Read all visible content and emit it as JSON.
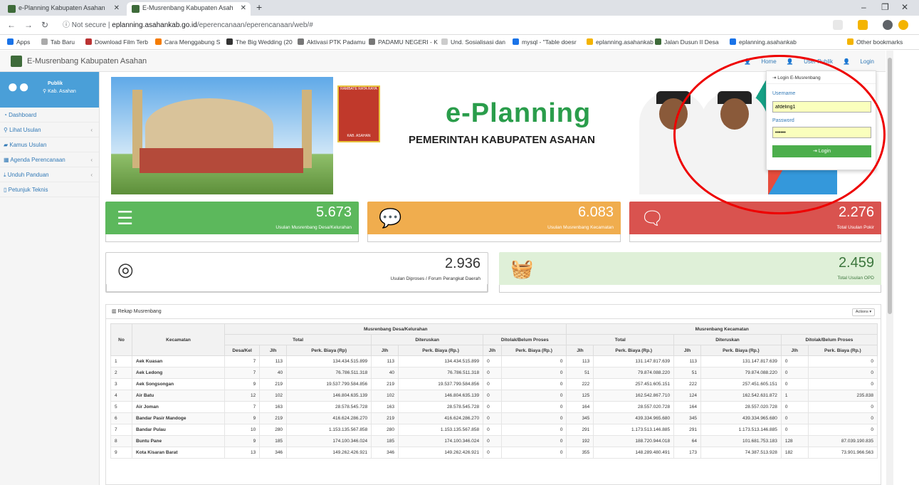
{
  "browser": {
    "tabs": [
      {
        "title": "e-Planning Kabupaten Asahan"
      },
      {
        "title": "E-Musrenbang Kabupaten Asah"
      }
    ],
    "url_prefix": "Not secure",
    "url_domain": "eplanning.asahankab.go.id",
    "url_path": "/eperencanaan/eperencanaan/web/#",
    "bookmarks": [
      "Apps",
      "Tab Baru",
      "Download Film Terb",
      "Cara Menggabung S",
      "The Big Wedding (20",
      "Aktivasi PTK Padamu",
      "PADAMU NEGERI - K",
      "Und. Sosialisasi dan",
      "mysql - \"Table doesr",
      "eplanning.asahankab",
      "Jalan Dusun II Desa",
      "eplanning.asahankab"
    ],
    "other_bookmarks": "Other bookmarks"
  },
  "app": {
    "title": "E-Musrenbang Kabupaten Asahan",
    "links": {
      "home": "Home",
      "user_publik": "User Publik",
      "login": "Login"
    }
  },
  "sidebar": {
    "user": "Publik",
    "location": "Kab. Asahan",
    "items": [
      {
        "label": "Dashboard",
        "has_children": false
      },
      {
        "label": "Lihat Usulan",
        "has_children": true
      },
      {
        "label": "Kamus Usulan",
        "has_children": false
      },
      {
        "label": "Agenda Perencanaan",
        "has_children": true
      },
      {
        "label": "Unduh Panduan",
        "has_children": true
      },
      {
        "label": "Petunjuk Teknis",
        "has_children": false
      }
    ]
  },
  "banner": {
    "brand": "e-Planning",
    "subtitle": "PEMERINTAH KABUPATEN ASAHAN",
    "emblem_top": "RAMBATE RATA RAYA",
    "emblem_bottom": "KAB. ASAHAN"
  },
  "login": {
    "header": "Login E-Musrenbang",
    "username_label": "Username",
    "username_value": "afdeling1",
    "password_label": "Password",
    "password_value": "••••••",
    "button": "Login"
  },
  "stats": [
    {
      "value": "5.673",
      "label": "Usulan Musrenbang Desa/Kelurahan",
      "color": "#5cb85c"
    },
    {
      "value": "6.083",
      "label": "Usulan Musrenbang Kecamatan",
      "color": "#f0ad4e"
    },
    {
      "value": "2.276",
      "label": "Total Usulan Pokir",
      "color": "#d9534f"
    },
    {
      "value": "2.936",
      "label": "Usulan Diproses / Forum Perangkat Daerah",
      "color": "#ffffff"
    },
    {
      "value": "2.459",
      "label": "Total Usulan OPD",
      "color": "#dff0d8"
    }
  ],
  "rekap": {
    "title": "Rekap Musrenbang",
    "actions": "Actions",
    "headers": {
      "no": "No",
      "kecamatan": "Kecamatan",
      "desa_group": "Musrenbang Desa/Kelurahan",
      "kec_group": "Musrenbang Kecamatan",
      "total": "Total",
      "diteruskan": "Diteruskan",
      "ditolak": "Ditolak/Belum Proses",
      "desakel": "Desa/Kel",
      "jlh": "Jlh",
      "biaya_rp": "Perk. Biaya (Rp)",
      "biaya_rp2": "Perk. Biaya (Rp.)"
    },
    "rows": [
      [
        "1",
        "Aek Kuasan",
        "7",
        "113",
        "134.434.515.899",
        "113",
        "134.434.515.899",
        "0",
        "0",
        "113",
        "131.147.817.639",
        "113",
        "131.147.817.639",
        "0",
        "0"
      ],
      [
        "2",
        "Aek Ledong",
        "7",
        "40",
        "76.786.511.318",
        "40",
        "76.786.511.318",
        "0",
        "0",
        "51",
        "79.874.088.220",
        "51",
        "79.874.088.220",
        "0",
        "0"
      ],
      [
        "3",
        "Aek Songsongan",
        "9",
        "219",
        "19.537.799.584.856",
        "219",
        "19.537.799.584.856",
        "0",
        "0",
        "222",
        "257.451.605.151",
        "222",
        "257.451.605.151",
        "0",
        "0"
      ],
      [
        "4",
        "Air Batu",
        "12",
        "102",
        "146.804.635.139",
        "102",
        "146.804.635.139",
        "0",
        "0",
        "125",
        "162.542.867.710",
        "124",
        "162.542.631.872",
        "1",
        "235.838"
      ],
      [
        "5",
        "Air Joman",
        "7",
        "163",
        "28.578.545.728",
        "163",
        "28.578.545.728",
        "0",
        "0",
        "164",
        "28.557.020.728",
        "164",
        "28.557.020.728",
        "0",
        "0"
      ],
      [
        "6",
        "Bandar Pasir Mandoge",
        "9",
        "219",
        "416.624.286.270",
        "219",
        "416.624.286.270",
        "0",
        "0",
        "345",
        "439.334.965.680",
        "345",
        "439.334.965.680",
        "0",
        "0"
      ],
      [
        "7",
        "Bandar Pulau",
        "10",
        "280",
        "1.153.135.567.858",
        "280",
        "1.153.135.567.858",
        "0",
        "0",
        "291",
        "1.173.513.146.885",
        "291",
        "1.173.513.146.885",
        "0",
        "0"
      ],
      [
        "8",
        "Buntu Pane",
        "9",
        "185",
        "174.100.346.024",
        "185",
        "174.100.346.024",
        "0",
        "0",
        "192",
        "188.720.944.018",
        "64",
        "101.681.753.183",
        "128",
        "87.039.190.835"
      ],
      [
        "9",
        "Kota Kisaran Barat",
        "13",
        "346",
        "149.262.426.921",
        "346",
        "149.262.426.921",
        "0",
        "0",
        "355",
        "148.289.480.491",
        "173",
        "74.387.513.928",
        "182",
        "73.901.966.563"
      ]
    ]
  }
}
